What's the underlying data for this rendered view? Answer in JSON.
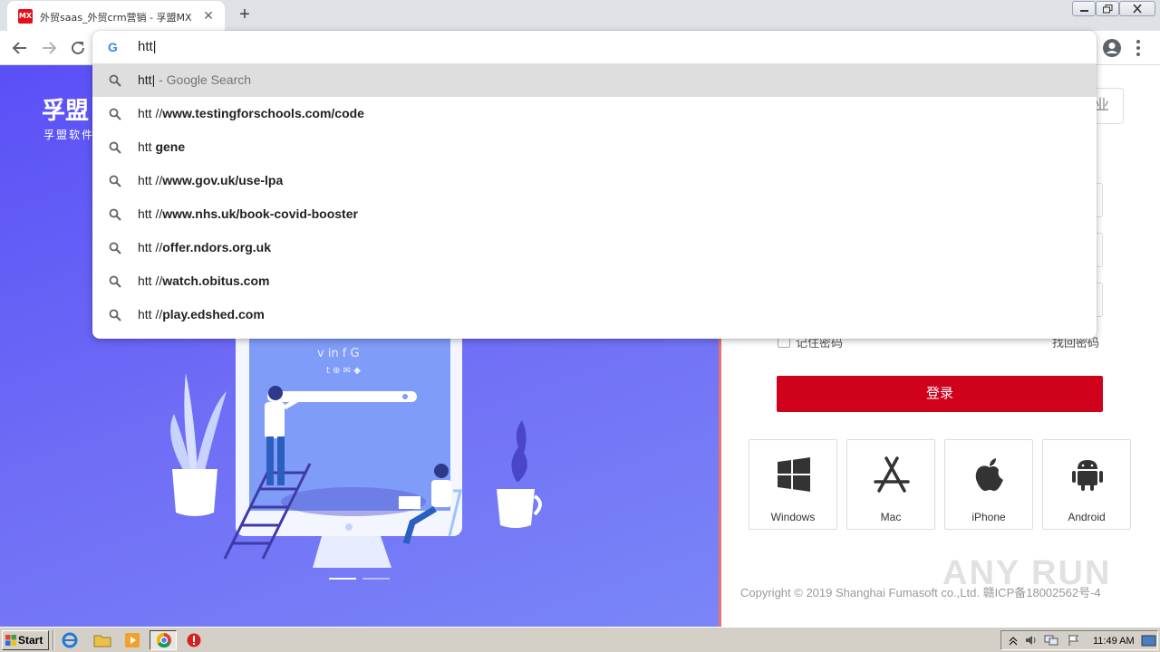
{
  "browser": {
    "tab": {
      "favicon_text": "MX",
      "title": "外贸saas_外贸crm营销 - 孚盟MX",
      "close_glyph": "✕"
    },
    "new_tab_glyph": "+",
    "omnibox": {
      "value": "htt|"
    }
  },
  "suggestions": [
    {
      "plain": "htt|",
      "bold": "",
      "suffix": " - Google Search"
    },
    {
      "plain": "htt //",
      "bold": "www.testingforschools.com/code",
      "suffix": ""
    },
    {
      "plain": "htt ",
      "bold": "gene",
      "suffix": ""
    },
    {
      "plain": "htt //",
      "bold": "www.gov.uk/use-lpa",
      "suffix": ""
    },
    {
      "plain": "htt //",
      "bold": "www.nhs.uk/book-covid-booster",
      "suffix": ""
    },
    {
      "plain": "htt //",
      "bold": "offer.ndors.org.uk",
      "suffix": ""
    },
    {
      "plain": "htt //",
      "bold": "watch.obitus.com",
      "suffix": ""
    },
    {
      "plain": "htt //",
      "bold": "play.edshed.com",
      "suffix": ""
    }
  ],
  "page": {
    "brand": "孚盟",
    "brand_sub": "孚盟软件",
    "top_button_partial": "业",
    "remember_label": "记住密码",
    "forgot_label": "找回密码",
    "login_label": "登录",
    "downloads": [
      {
        "label": "Windows",
        "icon": "windows-icon"
      },
      {
        "label": "Mac",
        "icon": "app-store-icon"
      },
      {
        "label": "iPhone",
        "icon": "apple-icon"
      },
      {
        "label": "Android",
        "icon": "android-icon"
      }
    ],
    "copyright": "Copyright © 2019 Shanghai Fumasoft co.,Ltd.  赣ICP备18002562号-4",
    "watermark": "ANY RUN"
  },
  "taskbar": {
    "start_label": "Start",
    "clock": "11:49 AM"
  },
  "colors": {
    "accent_red": "#d0021b",
    "hero_purple": "#6a66f6",
    "selected_row": "#dedede"
  }
}
